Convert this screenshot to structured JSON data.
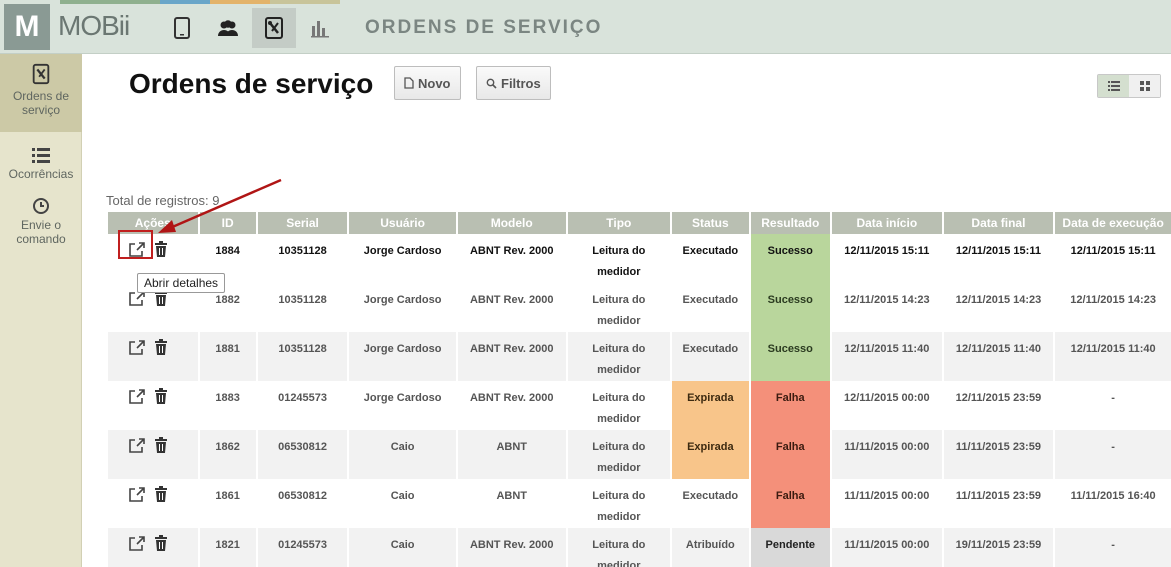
{
  "app": {
    "logo_letter": "M",
    "logo_text": "MOBii",
    "header_title": "ORDENS DE SERVIÇO"
  },
  "sidebar": {
    "items": [
      {
        "label": "Ordens de serviço"
      },
      {
        "label": "Ocorrências"
      },
      {
        "label": "Envie o comando"
      }
    ]
  },
  "main": {
    "title": "Ordens de serviço",
    "new_button": "Novo",
    "filters_button": "Filtros",
    "total_label": "Total de registros: 9",
    "tooltip": "Abrir detalhes"
  },
  "table": {
    "headers": [
      "Ações",
      "ID",
      "Serial",
      "Usuário",
      "Modelo",
      "Tipo",
      "Status",
      "Resultado",
      "Data início",
      "Data final",
      "Data de execução"
    ],
    "rows": [
      {
        "id": "1884",
        "serial": "10351128",
        "usuario": "Jorge Cardoso",
        "modelo": "ABNT Rev. 2000",
        "tipo": "Leitura do medidor",
        "status": "Executado",
        "resultado": "Sucesso",
        "inicio": "12/11/2015 15:11",
        "final": "12/11/2015 15:11",
        "execucao": "12/11/2015 15:11"
      },
      {
        "id": "1882",
        "serial": "10351128",
        "usuario": "Jorge Cardoso",
        "modelo": "ABNT Rev. 2000",
        "tipo": "Leitura do medidor",
        "status": "Executado",
        "resultado": "Sucesso",
        "inicio": "12/11/2015 14:23",
        "final": "12/11/2015 14:23",
        "execucao": "12/11/2015 14:23"
      },
      {
        "id": "1881",
        "serial": "10351128",
        "usuario": "Jorge Cardoso",
        "modelo": "ABNT Rev. 2000",
        "tipo": "Leitura do medidor",
        "status": "Executado",
        "resultado": "Sucesso",
        "inicio": "12/11/2015 11:40",
        "final": "12/11/2015 11:40",
        "execucao": "12/11/2015 11:40"
      },
      {
        "id": "1883",
        "serial": "01245573",
        "usuario": "Jorge Cardoso",
        "modelo": "ABNT Rev. 2000",
        "tipo": "Leitura do medidor",
        "status": "Expirada",
        "resultado": "Falha",
        "inicio": "12/11/2015 00:00",
        "final": "12/11/2015 23:59",
        "execucao": "-"
      },
      {
        "id": "1862",
        "serial": "06530812",
        "usuario": "Caio",
        "modelo": "ABNT",
        "tipo": "Leitura do medidor",
        "status": "Expirada",
        "resultado": "Falha",
        "inicio": "11/11/2015 00:00",
        "final": "11/11/2015 23:59",
        "execucao": "-"
      },
      {
        "id": "1861",
        "serial": "06530812",
        "usuario": "Caio",
        "modelo": "ABNT",
        "tipo": "Leitura do medidor",
        "status": "Executado",
        "resultado": "Falha",
        "inicio": "11/11/2015 00:00",
        "final": "11/11/2015 23:59",
        "execucao": "11/11/2015 16:40"
      },
      {
        "id": "1821",
        "serial": "01245573",
        "usuario": "Caio",
        "modelo": "ABNT Rev. 2000",
        "tipo": "Leitura do medidor",
        "status": "Atribuído",
        "resultado": "Pendente",
        "inicio": "11/11/2015 00:00",
        "final": "19/11/2015 23:59",
        "execucao": "-"
      }
    ]
  },
  "colors": {
    "sucesso": "#b9d69c",
    "falha": "#f4907a",
    "expirada": "#f8c58a",
    "pendente": "#d9d9d9",
    "header": "#b9bfb2",
    "sidebar": "#e6e4cc",
    "annotation": "#c01f1f"
  },
  "icons": {
    "top_nav": [
      "tablet-icon",
      "users-icon",
      "tools-icon",
      "bar-chart-icon"
    ],
    "row_actions": [
      "external-link-icon",
      "trash-icon"
    ]
  }
}
